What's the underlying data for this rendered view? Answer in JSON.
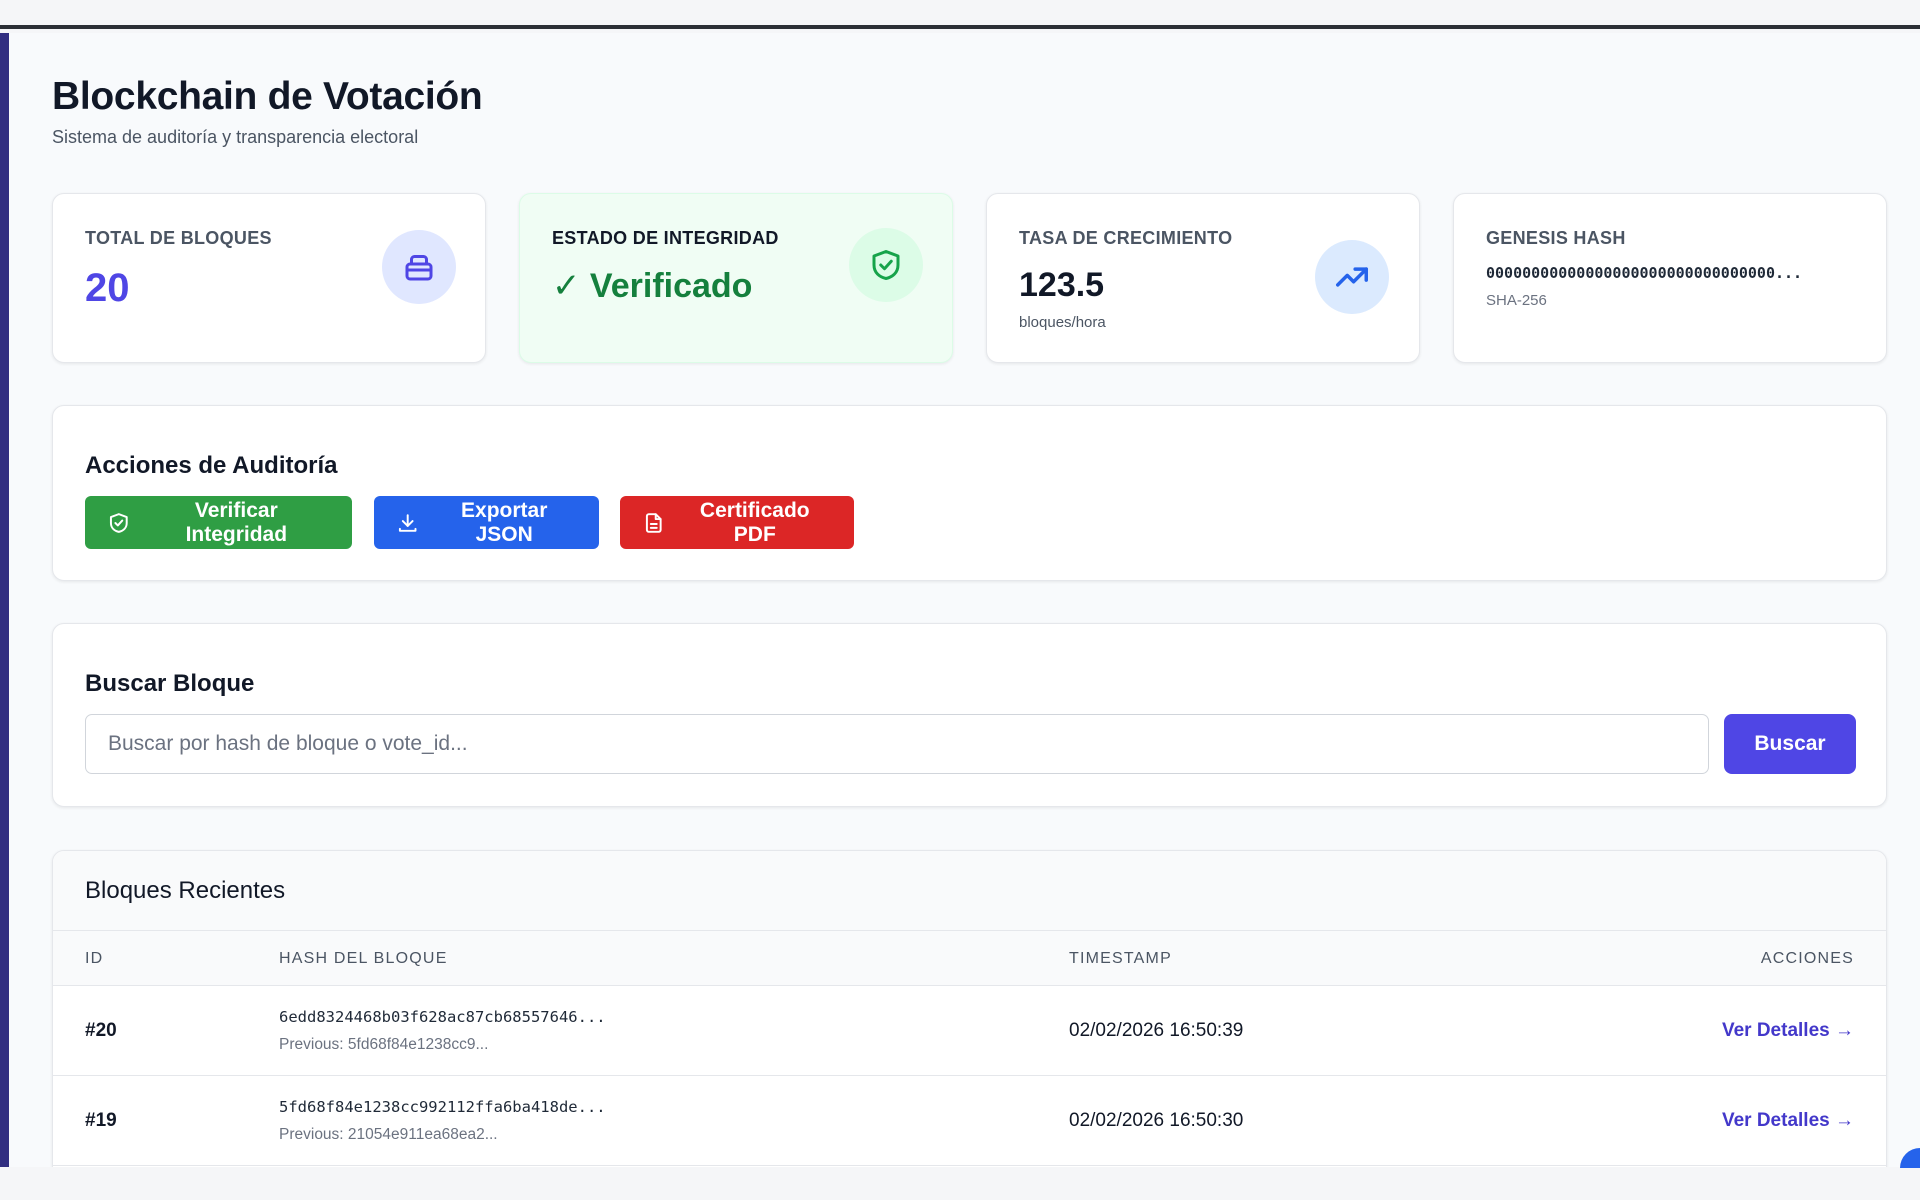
{
  "header": {
    "title": "Blockchain de Votación",
    "subtitle": "Sistema de auditoría y transparencia electoral"
  },
  "stats": {
    "total_blocks": {
      "label": "TOTAL DE BLOQUES",
      "value": "20",
      "icon": "database-icon"
    },
    "integrity": {
      "label": "ESTADO DE INTEGRIDAD",
      "value": "✓ Verificado",
      "icon": "shield-check-icon"
    },
    "growth": {
      "label": "TASA DE CRECIMIENTO",
      "value": "123.5",
      "unit": "bloques/hora",
      "icon": "trending-up-icon"
    },
    "genesis": {
      "label": "GENESIS HASH",
      "value": "00000000000000000000000000000000...",
      "algo": "SHA-256"
    }
  },
  "actions": {
    "title": "Acciones de Auditoría",
    "verify_label": "Verificar Integridad",
    "export_label": "Exportar JSON",
    "pdf_label": "Certificado PDF"
  },
  "search": {
    "title": "Buscar Bloque",
    "placeholder": "Buscar por hash de bloque o vote_id...",
    "button_label": "Buscar"
  },
  "recent": {
    "title": "Bloques Recientes",
    "columns": [
      "ID",
      "HASH DEL BLOQUE",
      "TIMESTAMP",
      "ACCIONES"
    ],
    "rows": [
      {
        "id": "#20",
        "hash": "6edd8324468b03f628ac87cb68557646...",
        "previous": "Previous: 5fd68f84e1238cc9...",
        "timestamp": "02/02/2026 16:50:39",
        "action": "Ver Detalles →"
      },
      {
        "id": "#19",
        "hash": "5fd68f84e1238cc992112ffa6ba418de...",
        "previous": "Previous: 21054e911ea68ea2...",
        "timestamp": "02/02/2026 16:50:30",
        "action": "Ver Detalles →"
      }
    ]
  },
  "colors": {
    "accent": "#4f46e5",
    "success": "#2f9e44",
    "primary": "#2563eb",
    "danger": "#dc2626"
  }
}
